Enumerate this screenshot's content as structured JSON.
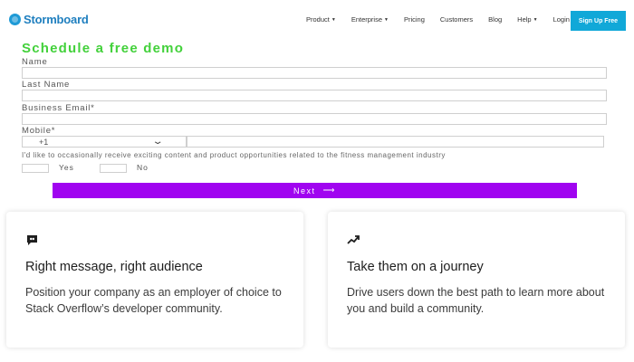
{
  "nav": {
    "logo_text": "Stormboard",
    "links": [
      {
        "label": "Product",
        "dropdown": true
      },
      {
        "label": "Enterprise",
        "dropdown": true
      },
      {
        "label": "Pricing",
        "dropdown": false
      },
      {
        "label": "Customers",
        "dropdown": false
      },
      {
        "label": "Blog",
        "dropdown": false
      },
      {
        "label": "Help",
        "dropdown": true
      },
      {
        "label": "Login →",
        "dropdown": false
      }
    ],
    "signup_label": "Sign Up Free",
    "signup_color": "#11a8d8"
  },
  "form": {
    "title": "Schedule a free demo",
    "title_color": "#43d13b",
    "fields": [
      {
        "label": "Name",
        "value": ""
      },
      {
        "label": "Last Name",
        "value": ""
      },
      {
        "label": "Business Email*",
        "value": ""
      }
    ],
    "mobile_label": "Mobile*",
    "country_code": "+1",
    "phone_value": "",
    "consent_text": "I'd like to occasionally receive exciting content and product opportunities related to the fitness management industry",
    "choices": [
      "Yes",
      "No"
    ],
    "next_label": "Next",
    "next_color": "#a004f0"
  },
  "cards": [
    {
      "icon": "quote-bubble-icon",
      "title": "Right message, right audience",
      "body": "Position your company as an employer of choice to Stack Overflow’s developer community."
    },
    {
      "icon": "trending-up-icon",
      "title": "Take them on a journey",
      "body": "Drive users down the best path to learn more about you and build a community."
    }
  ]
}
